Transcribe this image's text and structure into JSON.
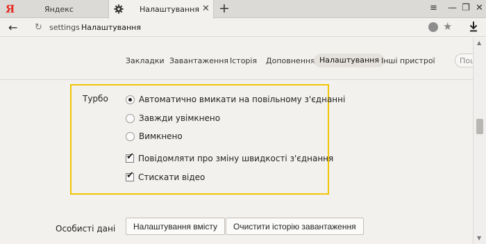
{
  "tabs": [
    {
      "title": "Яндекс",
      "logo": "Я"
    },
    {
      "title": "Налаштування",
      "icon": "gear-icon"
    }
  ],
  "window_controls": {
    "menu": "≡",
    "minimize": "—",
    "restore": "❐",
    "close": "✕"
  },
  "tab_close": "✕",
  "new_tab": "+",
  "address": {
    "back": "←",
    "reload": "↻",
    "prefix": "settings",
    "title": "Налаштування",
    "star": "★"
  },
  "nav": {
    "items": [
      "Закладки",
      "Завантаження",
      "Історія",
      "Доповнення",
      "Налаштування",
      "Інші пристрої"
    ],
    "active_index": 4,
    "search_placeholder": "Пош"
  },
  "turbo": {
    "label": "Турбо",
    "radio_options": [
      {
        "text": "Автоматично вмикати на повільному з'єднанні",
        "selected": true
      },
      {
        "text": "Завжди увімкнено",
        "selected": false
      },
      {
        "text": "Вимкнено",
        "selected": false
      }
    ],
    "checkboxes": [
      {
        "text": "Повідомляти про зміну швидкості з'єднання",
        "checked": true
      },
      {
        "text": "Стискати відео",
        "checked": true
      }
    ],
    "highlight_color": "#f2c400"
  },
  "personal": {
    "label": "Особисті дані",
    "buttons": [
      "Налаштування вмісту",
      "Очистити історію завантаження"
    ]
  },
  "colors": {
    "brand": "#e52620"
  }
}
